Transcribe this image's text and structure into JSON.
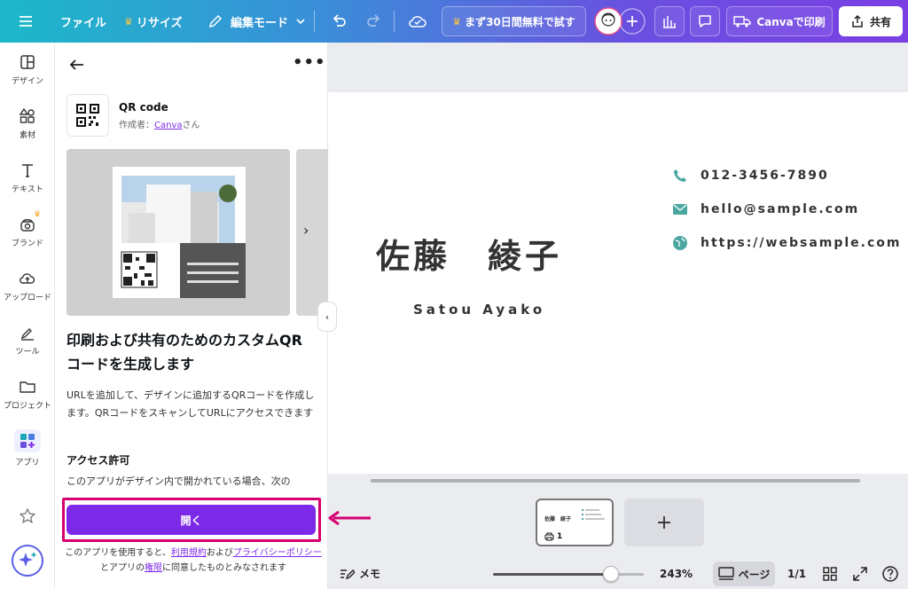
{
  "topbar": {
    "file": "ファイル",
    "resize": "リサイズ",
    "edit_mode": "編集モード",
    "trial": "まず30日間無料で試す",
    "print": "Canvaで印刷",
    "share": "共有"
  },
  "rail": {
    "items": [
      {
        "label": "デザイン"
      },
      {
        "label": "素材"
      },
      {
        "label": "テキスト"
      },
      {
        "label": "ブランド"
      },
      {
        "label": "アップロード"
      },
      {
        "label": "ツール"
      },
      {
        "label": "プロジェクト"
      },
      {
        "label": "アプリ"
      }
    ]
  },
  "panel": {
    "app_name": "QR code",
    "author_prefix": "作成者：",
    "author_link": "Canva",
    "author_suffix": "さん",
    "heading": "印刷および共有のためのカスタムQRコードを生成します",
    "description": "URLを追加して、デザインに追加するQRコードを作成します。QRコードをスキャンしてURLにアクセスできます",
    "access_title": "アクセス許可",
    "access_text": "このアプリがデザイン内で開かれている場合、次の",
    "open_button": "開く",
    "terms": {
      "t1": "このアプリを使用すると、",
      "link1": "利用規約",
      "t2": "および",
      "link2": "プライバシーポリシー",
      "t3": "とアプリの",
      "link3": "権限",
      "t4": "に同意したものとみなされます"
    }
  },
  "card": {
    "name_jp": "佐藤　綾子",
    "name_en": "Satou Ayako",
    "phone": "012-3456-7890",
    "email": "hello@sample.com",
    "website": "https://websample.com"
  },
  "pages": {
    "thumb_name": "佐藤　綾子",
    "thumb_number": "1",
    "add": "+"
  },
  "bottombar": {
    "memo": "メモ",
    "zoom": "243%",
    "zoom_fraction": 0.78,
    "pages_label": "ページ",
    "page_count": "1/1"
  },
  "colors": {
    "accent": "#7d2ae8",
    "highlight_frame": "#d6006e",
    "icon_teal": "#4aa7a0"
  }
}
